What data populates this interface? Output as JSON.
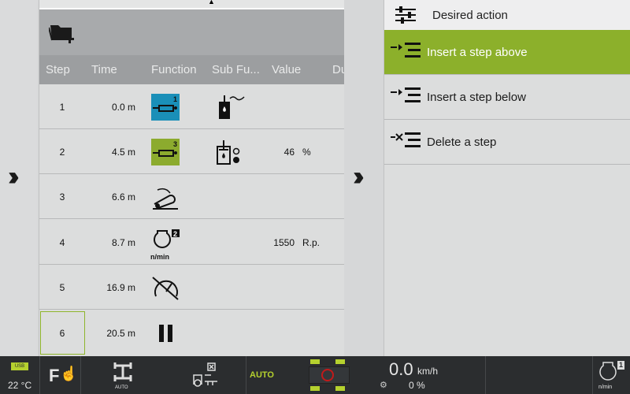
{
  "table": {
    "columns": [
      "Step",
      "Time",
      "Function",
      "Sub Fu...",
      "Value",
      "Du"
    ],
    "rows": [
      {
        "step": "1",
        "time": "0.0  m",
        "function_icon": "hydraulic-cylinder-1-icon",
        "function_badge": "1",
        "function_color": "#1a8fb8",
        "sub_icon": "oil-tank-float-icon",
        "value": "",
        "unit": ""
      },
      {
        "step": "2",
        "time": "4.5  m",
        "function_icon": "hydraulic-cylinder-3-icon",
        "function_badge": "3",
        "function_color": "#8cab2e",
        "sub_icon": "oil-tank-position-icon",
        "value": "46",
        "unit": "%"
      },
      {
        "step": "3",
        "time": "6.6  m",
        "function_icon": "pickup-icon",
        "value": "",
        "unit": ""
      },
      {
        "step": "4",
        "time": "8.7  m",
        "function_icon": "engine-speed-2-icon",
        "function_badge": "2",
        "function_sub": "n/min",
        "value": "1550",
        "unit": "R.p."
      },
      {
        "step": "5",
        "time": "16.9  m",
        "function_icon": "speed-off-icon",
        "value": "",
        "unit": ""
      },
      {
        "step": "6",
        "time": "20.5  m",
        "function_icon": "pause-icon",
        "value": "",
        "unit": ""
      }
    ]
  },
  "right": {
    "title": "Desired action",
    "items": [
      {
        "label": "Insert a step above",
        "icon": "insert-above-icon",
        "active": true
      },
      {
        "label": "Insert a step below",
        "icon": "insert-below-icon"
      },
      {
        "label": "Delete a step",
        "icon": "delete-step-icon"
      }
    ]
  },
  "status": {
    "usb": "USB",
    "temperature": "22 °C",
    "f_key": "F",
    "steering_mode": "AUTO",
    "auto": "AUTO",
    "speed": "0.0",
    "speed_unit": "km/h",
    "slip": "0 %",
    "engine_badge": "1",
    "engine_unit": "n/min"
  },
  "colors": {
    "accent": "#8cb02b",
    "blue": "#1a8fb8",
    "bar": "#2b2d2f"
  }
}
